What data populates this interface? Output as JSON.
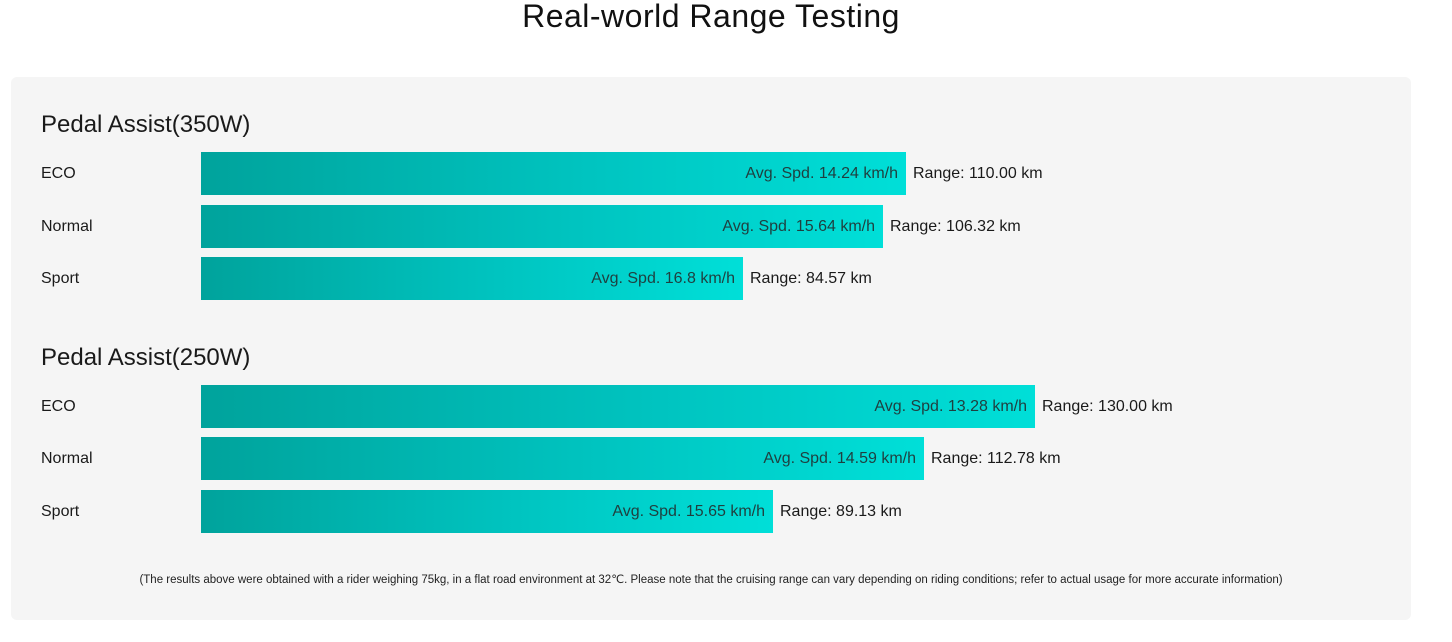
{
  "title": "Real-world Range Testing",
  "footnote": "(The results above were obtained with a rider weighing 75kg, in a flat road environment at 32℃. Please note that the cruising range can vary depending on riding conditions; refer to actual usage for more accurate information)",
  "colors": {
    "bar_start": "#00a39c",
    "bar_end": "#00dfd8",
    "panel_background": "#f5f5f5"
  },
  "chart_data": {
    "type": "bar",
    "orientation": "horizontal",
    "value_max": 138,
    "groups": [
      {
        "title": "Pedal Assist(350W)",
        "rows": [
          {
            "mode": "ECO",
            "speed_label": "Avg. Spd. 14.24 km/h",
            "range_label": "Range: 110.00 km",
            "range_km": 110.0,
            "speed_kmh": 14.24
          },
          {
            "mode": "Normal",
            "speed_label": "Avg. Spd. 15.64 km/h",
            "range_label": "Range: 106.32 km",
            "range_km": 106.32,
            "speed_kmh": 15.64
          },
          {
            "mode": "Sport",
            "speed_label": "Avg. Spd. 16.8 km/h",
            "range_label": "Range: 84.57 km",
            "range_km": 84.57,
            "speed_kmh": 16.8
          }
        ]
      },
      {
        "title": "Pedal Assist(250W)",
        "rows": [
          {
            "mode": "ECO",
            "speed_label": "Avg. Spd. 13.28 km/h",
            "range_label": "Range: 130.00 km",
            "range_km": 130.0,
            "speed_kmh": 13.28
          },
          {
            "mode": "Normal",
            "speed_label": "Avg. Spd. 14.59 km/h",
            "range_label": "Range: 112.78 km",
            "range_km": 112.78,
            "speed_kmh": 14.59
          },
          {
            "mode": "Sport",
            "speed_label": "Avg. Spd. 15.65 km/h",
            "range_label": "Range: 89.13 km",
            "range_km": 89.13,
            "speed_kmh": 15.65
          }
        ]
      }
    ]
  }
}
